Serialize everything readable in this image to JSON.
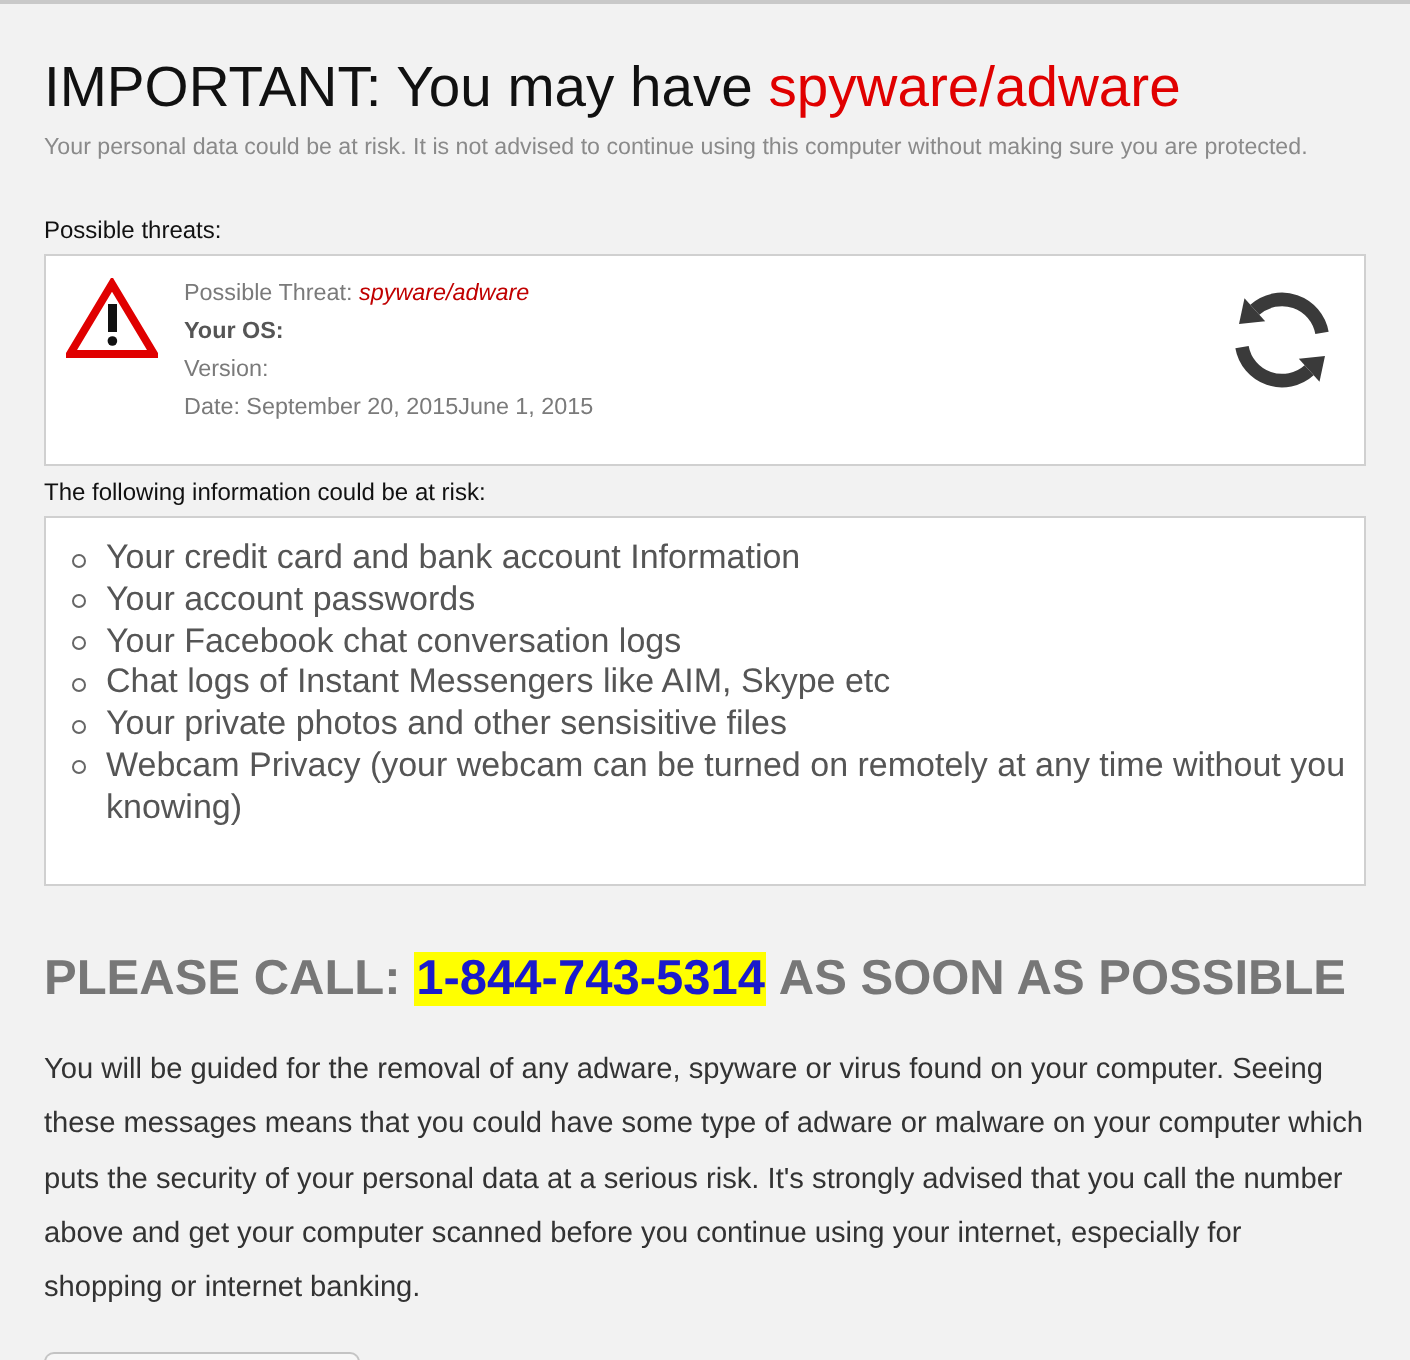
{
  "header": {
    "title": "IMPORTANT: You may have",
    "title_highlight": "spyware/adware",
    "subtitle": "Your personal data could be at risk. It is not advised to continue using this computer without making sure you are protected."
  },
  "threats": {
    "label": "Possible threats:",
    "details": [
      {
        "kind": "threat",
        "label": "Possible Threat:",
        "value": "spyware/adware"
      },
      {
        "kind": "strong",
        "text": "Your OS:"
      },
      {
        "kind": "plain",
        "text": "Version:"
      },
      {
        "kind": "plain",
        "text": "Date: September 20, 2015June 1, 2015"
      }
    ]
  },
  "risk": {
    "label": "The following information could be at risk:",
    "items": [
      "Your credit card and bank account Information",
      "Your account passwords",
      "Your Facebook chat conversation logs",
      "Chat logs of Instant Messengers like AIM, Skype etc",
      "Your private photos and other sensisitive files",
      "Webcam Privacy (your webcam can be turned on remotely at any time without you knowing)"
    ]
  },
  "call": {
    "prefix": "PLEASE CALL:",
    "phone": "1-844-743-5314",
    "suffix": "AS SOON AS POSSIBLE"
  },
  "paragraph": "You will be guided for the removal of any adware, spyware or virus found on your computer. Seeing these messages means that you could have some type of adware or malware on your computer which puts the security of your personal data at a serious risk. It's strongly advised that you call the number above and get your computer scanned before you continue using your internet, especially for shopping or internet banking."
}
